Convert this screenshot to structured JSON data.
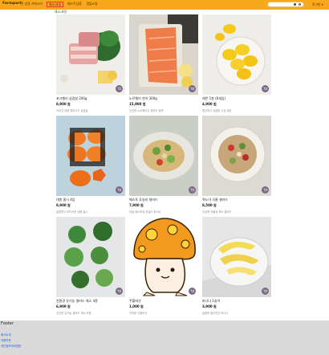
{
  "header": {
    "brand": "Farmpart",
    "nav": [
      "전 상품 카테고리",
      "채소/과일",
      "베스트상품",
      "알뜰쇼핑"
    ],
    "login": "로그인 ▾"
  },
  "breadcrumb": "채소/과일",
  "products": [
    {
      "name": "포크벨리 삼겹살 200g",
      "price": "8,900 원",
      "desc": "국내산 냉장 돼지고기 삼겹살"
    },
    {
      "name": "노르웨이 연어 300g",
      "price": "15,900 원",
      "desc": "신선한 노르웨이산 생연어 필렛"
    },
    {
      "name": "레몬 1봉 (6개입)",
      "price": "4,900 원",
      "desc": "향긋하고 상큼한 수입 레몬"
    },
    {
      "name": "대봉 홍시 4입",
      "price": "9,900 원",
      "desc": "달콤하고 부드러운 대봉 홍시"
    },
    {
      "name": "페스토 푸실리 샐러드",
      "price": "7,900 원",
      "desc": "바질 페스토와 푸실리 파스타"
    },
    {
      "name": "퀴노아 곡물 샐러드",
      "price": "8,500 원",
      "desc": "건강한 곡물과 채소 샐러드"
    },
    {
      "name": "친환경 유기농 샐러드 채소 4종",
      "price": "6,900 원",
      "desc": "신선한 유기농 샐러드 채소 모음"
    },
    {
      "name": "주황버섯",
      "price": "1,000 원",
      "desc": "귀여운 주황버섯"
    },
    {
      "name": "바나나 1송이",
      "price": "3,900 원",
      "desc": "달콤한 필리핀산 바나나"
    }
  ],
  "footer": {
    "title": "Footer",
    "links": [
      "회사소개",
      "이용약관",
      "개인정보처리방침"
    ]
  }
}
